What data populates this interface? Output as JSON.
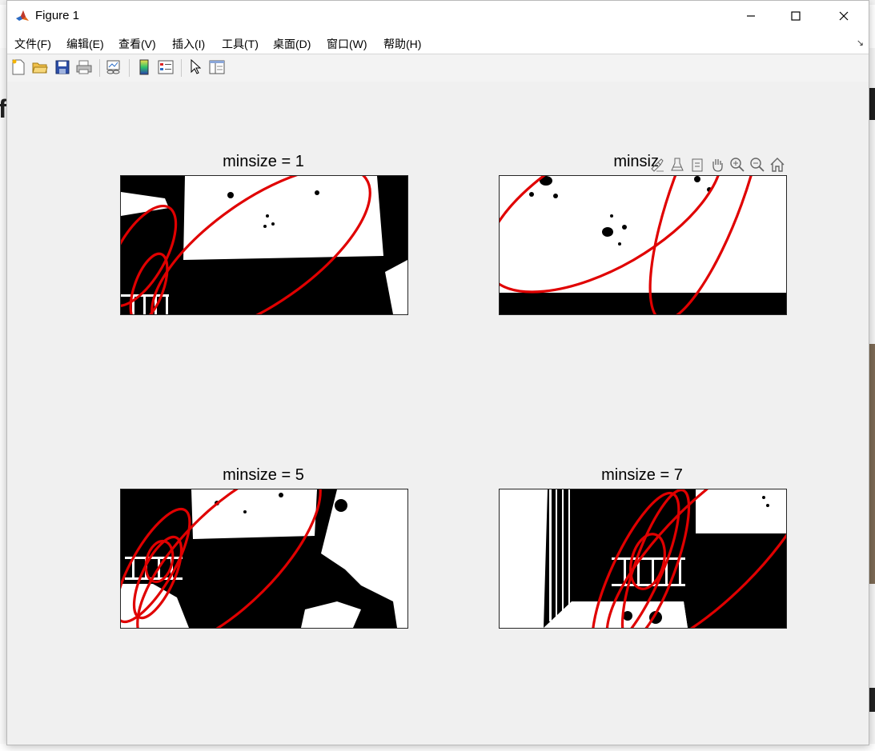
{
  "window": {
    "title": "Figure 1"
  },
  "menu": [
    {
      "label": "文件(F)"
    },
    {
      "label": "编辑(E)"
    },
    {
      "label": "查看(V)"
    },
    {
      "label": "插入(I)"
    },
    {
      "label": "工具(T)"
    },
    {
      "label": "桌面(D)"
    },
    {
      "label": "窗口(W)"
    },
    {
      "label": "帮助(H)"
    }
  ],
  "toolbar_icons": [
    "new-figure-icon",
    "open-file-icon",
    "save-icon",
    "print-icon",
    "link-plot-icon",
    "colorbar-icon",
    "legend-icon",
    "pointer-icon",
    "property-inspector-icon"
  ],
  "axes": [
    {
      "title": "minsize = 1"
    },
    {
      "title": "minsize = 3",
      "title_visible": "minsiz"
    },
    {
      "title": "minsize = 5"
    },
    {
      "title": "minsize = 7"
    }
  ],
  "axes_toolbar_icons": [
    "brush-icon",
    "data-tips-icon",
    "export-icon",
    "pan-icon",
    "zoom-in-icon",
    "zoom-out-icon",
    "home-icon"
  ],
  "colors": {
    "ellipse": "#e00000",
    "accent_window": "#ffffff"
  }
}
